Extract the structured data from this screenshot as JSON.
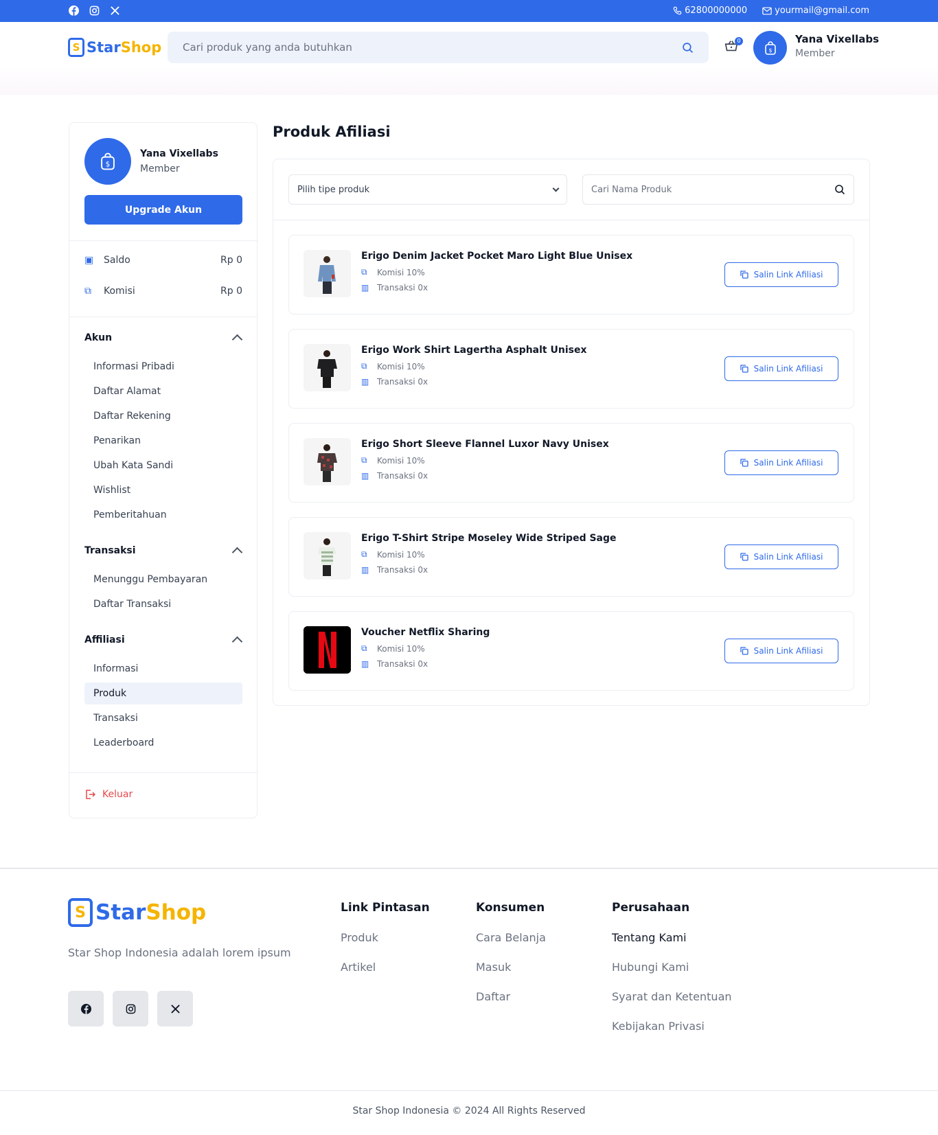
{
  "topbar": {
    "phone": "62800000000",
    "email": "yourmail@gmail.com",
    "socials": [
      "facebook-icon",
      "instagram-icon",
      "x-icon"
    ]
  },
  "logo": {
    "star": "Star",
    "shop": "Shop"
  },
  "search": {
    "placeholder": "Cari produk yang anda butuhkan"
  },
  "cart": {
    "count": "0"
  },
  "user": {
    "name": "Yana Vixellabs",
    "role": "Member"
  },
  "sidebar": {
    "upgrade_label": "Upgrade Akun",
    "balances": [
      {
        "label": "Saldo",
        "value": "Rp 0"
      },
      {
        "label": "Komisi",
        "value": "Rp 0"
      }
    ],
    "sections": [
      {
        "title": "Akun",
        "items": [
          "Informasi Pribadi",
          "Daftar Alamat",
          "Daftar Rekening",
          "Penarikan",
          "Ubah Kata Sandi",
          "Wishlist",
          "Pemberitahuan"
        ]
      },
      {
        "title": "Transaksi",
        "items": [
          "Menunggu Pembayaran",
          "Daftar Transaksi"
        ]
      },
      {
        "title": "Affiliasi",
        "items": [
          "Informasi",
          "Produk",
          "Transaksi",
          "Leaderboard"
        ]
      }
    ],
    "logout_label": "Keluar"
  },
  "main": {
    "title": "Produk Afiliasi",
    "filter_select": "Pilih tipe produk",
    "search_placeholder": "Cari Nama Produk",
    "copy_label": "Salin Link Afiliasi",
    "products": [
      {
        "name": "Erigo Denim Jacket Pocket Maro Light Blue Unisex",
        "commission": "Komisi 10%",
        "transactions": "Transaksi 0x"
      },
      {
        "name": "Erigo Work Shirt Lagertha Asphalt Unisex",
        "commission": "Komisi 10%",
        "transactions": "Transaksi 0x"
      },
      {
        "name": "Erigo Short Sleeve Flannel Luxor Navy Unisex",
        "commission": "Komisi 10%",
        "transactions": "Transaksi 0x"
      },
      {
        "name": "Erigo T-Shirt Stripe Moseley Wide Striped Sage",
        "commission": "Komisi 10%",
        "transactions": "Transaksi 0x"
      },
      {
        "name": "Voucher Netflix Sharing",
        "commission": "Komisi 10%",
        "transactions": "Transaksi 0x"
      }
    ]
  },
  "footer": {
    "tagline": "Star Shop Indonesia adalah lorem ipsum",
    "columns": [
      {
        "title": "Link Pintasan",
        "links": [
          "Produk",
          "Artikel"
        ]
      },
      {
        "title": "Konsumen",
        "links": [
          "Cara Belanja",
          "Masuk",
          "Daftar"
        ]
      },
      {
        "title": "Perusahaan",
        "links": [
          "Tentang Kami",
          "Hubungi Kami",
          "Syarat dan Ketentuan",
          "Kebijakan Privasi"
        ]
      }
    ],
    "copyright": "Star Shop Indonesia © 2024 All Rights Reserved"
  },
  "colors": {
    "primary": "#2f6ae8",
    "accent": "#f5b400",
    "danger": "#e5484d"
  }
}
